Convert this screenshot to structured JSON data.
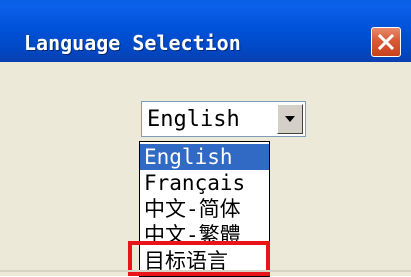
{
  "window": {
    "title": "Language Selection"
  },
  "combo": {
    "selected": "English"
  },
  "dropdown": {
    "items": [
      "English",
      "Français",
      "中文-简体",
      "中文-繁體",
      "目标语言"
    ],
    "selected_index": 0,
    "highlighted_item": "目标语言"
  },
  "colors": {
    "titlebar": "#0052d9",
    "selection": "#316ac5",
    "highlight_border": "#e8141a",
    "dialog_bg": "#ece9d8"
  }
}
